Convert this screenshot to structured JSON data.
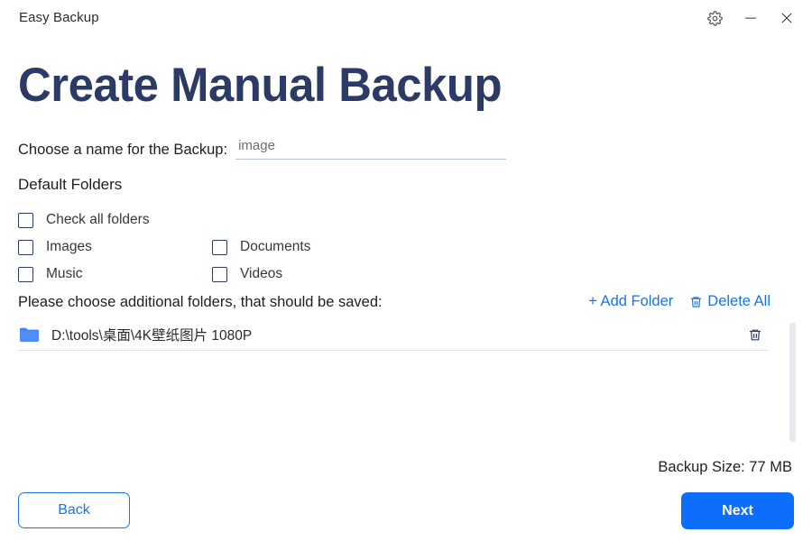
{
  "window": {
    "app_title": "Easy Backup",
    "controls": [
      {
        "name": "settings-button",
        "icon": "gear-icon",
        "label": ""
      },
      {
        "name": "minimize-button",
        "icon": "minimize-icon",
        "label": ""
      },
      {
        "name": "close-button",
        "icon": "close-icon",
        "label": ""
      }
    ]
  },
  "page": {
    "title": "Create Manual Backup"
  },
  "backup_name": {
    "label": "Choose a name for the Backup:",
    "value": "image",
    "placeholder": "image"
  },
  "default_folders": {
    "heading": "Default Folders",
    "check_all": {
      "label": "Check all folders",
      "checked": false
    },
    "items": [
      {
        "label": "Images",
        "checked": false
      },
      {
        "label": "Documents",
        "checked": false
      },
      {
        "label": "Music",
        "checked": false
      },
      {
        "label": "Videos",
        "checked": false
      }
    ]
  },
  "additional_folders": {
    "label": "Please choose additional folders, that should be saved:",
    "add_label": "+ Add Folder",
    "delete_all_label": "Delete All",
    "rows": [
      {
        "path": "D:\\tools\\桌面\\4K壁纸图片 1080P"
      }
    ]
  },
  "footer": {
    "backup_size": "Backup Size: 77 MB",
    "back_label": "Back",
    "next_label": "Next"
  },
  "colors": {
    "accent_blue": "#1a73e8",
    "primary_button": "#0d6efd",
    "heading_navy": "#2c3a66",
    "folder_icon": "#4285f4",
    "scrollbar": "#e6e9f1"
  }
}
